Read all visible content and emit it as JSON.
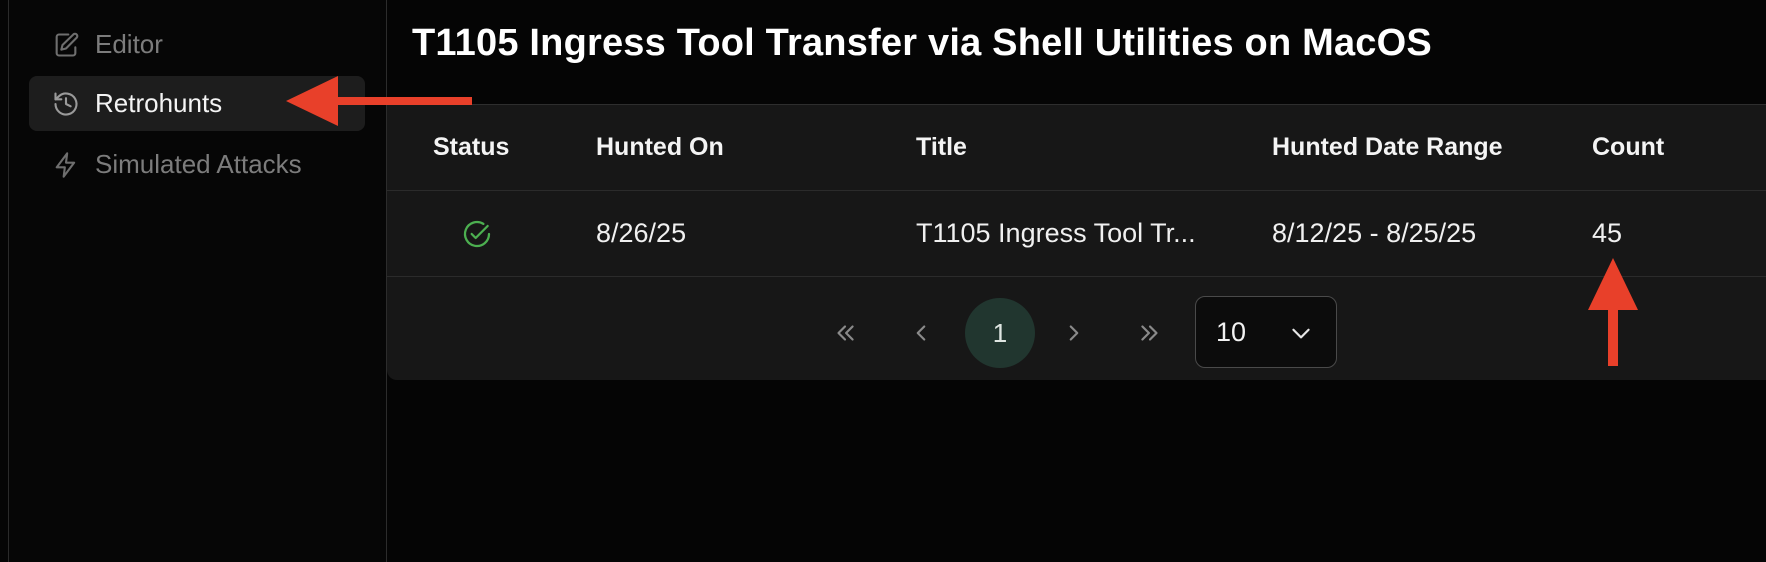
{
  "sidebar": {
    "items": [
      {
        "label": "Editor",
        "icon": "edit-icon",
        "active": false
      },
      {
        "label": "Retrohunts",
        "icon": "history-icon",
        "active": true
      },
      {
        "label": "Simulated Attacks",
        "icon": "lightning-icon",
        "active": false
      }
    ]
  },
  "page": {
    "title": "T1105 Ingress Tool Transfer via Shell Utilities on MacOS"
  },
  "table": {
    "columns": [
      "Status",
      "Hunted On",
      "Title",
      "Hunted Date Range",
      "Count"
    ],
    "rows": [
      {
        "status": "completed",
        "hunted_on": "8/26/25",
        "title": "T1105 Ingress Tool Tr...",
        "date_range": "8/12/25 - 8/25/25",
        "count": "45"
      }
    ]
  },
  "pagination": {
    "current_page": "1",
    "page_size": "10"
  },
  "colors": {
    "accent_green": "#4caf50",
    "annotation_red": "#e8402a",
    "current_page_bg": "#21362f"
  }
}
